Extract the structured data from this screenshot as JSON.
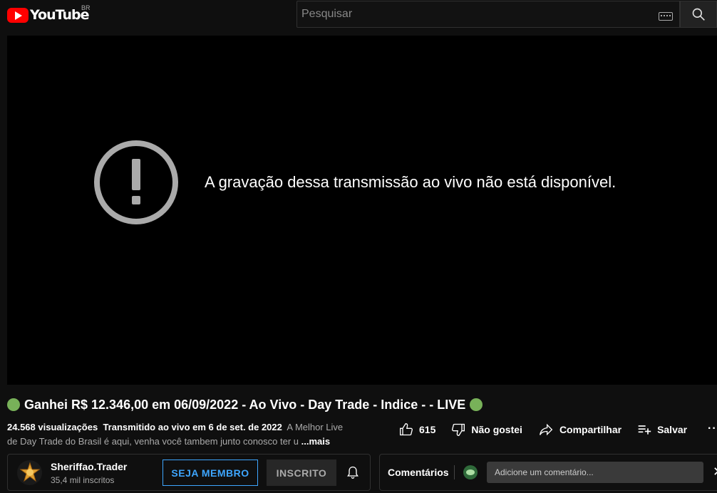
{
  "header": {
    "logo_text": "YouTube",
    "country_code": "BR",
    "search_placeholder": "Pesquisar"
  },
  "player": {
    "error_message": "A gravação dessa transmissão ao vivo não está disponível."
  },
  "video": {
    "title": "Ganhei R$ 12.346,00 em 06/09/2022 - Ao Vivo - Day Trade - Indice - - LIVE",
    "views": "24.568 visualizações",
    "streamed": "Transmitido ao vivo em 6 de set. de 2022",
    "description_line1": "A Melhor Live",
    "description_line2": "de Day Trade do Brasil é aqui, venha você tambem junto conosco ter u",
    "more_label": "...mais"
  },
  "actions": {
    "like_count": "615",
    "dislike_label": "Não gostei",
    "share_label": "Compartilhar",
    "save_label": "Salvar",
    "more_label": "···"
  },
  "channel": {
    "name": "Sheriffao.Trader",
    "subscribers": "35,4 mil inscritos",
    "member_button": "SEJA MEMBRO",
    "subscribed_button": "INSCRITO"
  },
  "comments": {
    "label": "Comentários",
    "input_placeholder": "Adicione um comentário...",
    "close_label": "✕"
  },
  "colors": {
    "background": "#0f0f0f",
    "player_bg": "#000000",
    "youtube_red": "#ff0000",
    "member_blue": "#3ea6ff",
    "title_dot": "#78b159"
  }
}
